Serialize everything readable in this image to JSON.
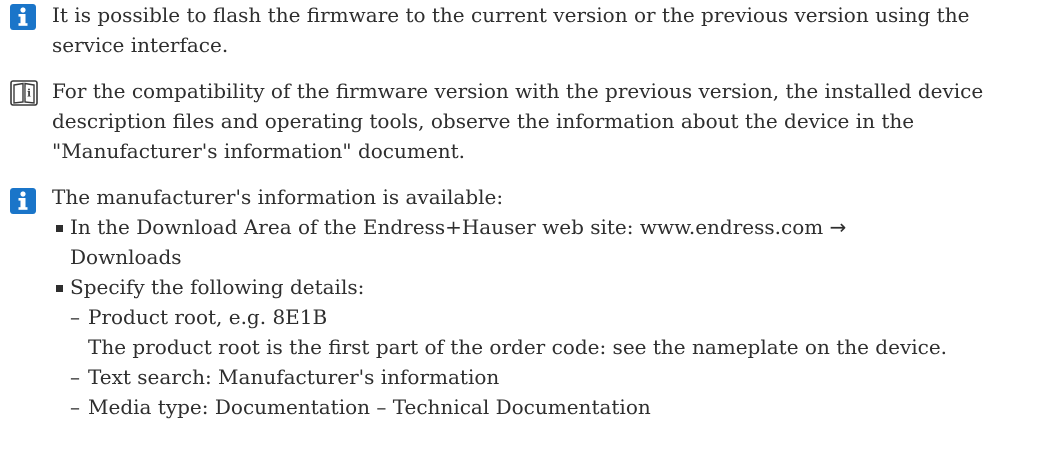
{
  "notes": [
    {
      "icon": "info-icon",
      "text": "It is possible to flash the firmware to the current version or the previous version using the service interface."
    },
    {
      "icon": "book-reference-icon",
      "text": "For the compatibility of the firmware version with the previous version, the installed device description files and operating tools, observe the information about the device in the \"Manufacturer's information\" document."
    },
    {
      "icon": "info-icon",
      "intro": "The manufacturer's information is available:",
      "bullets": [
        {
          "text_before_arrow": "In the Download Area of the Endress+Hauser web site: www.endress.com",
          "arrow": "→",
          "text_after_arrow": "Downloads"
        },
        {
          "text": "Specify the following details:",
          "sub_items": [
            {
              "text": "Product root, e.g. 8E1B",
              "detail": "The product root is the first part of the order code: see the nameplate on the device."
            },
            {
              "text": "Text search: Manufacturer's information"
            },
            {
              "text": "Media type: Documentation – Technical Documentation"
            }
          ]
        }
      ]
    }
  ],
  "colors": {
    "info_icon_bg": "#1a75c9",
    "book_icon_stroke": "#3a3a3a",
    "text": "#2e2e2e"
  }
}
